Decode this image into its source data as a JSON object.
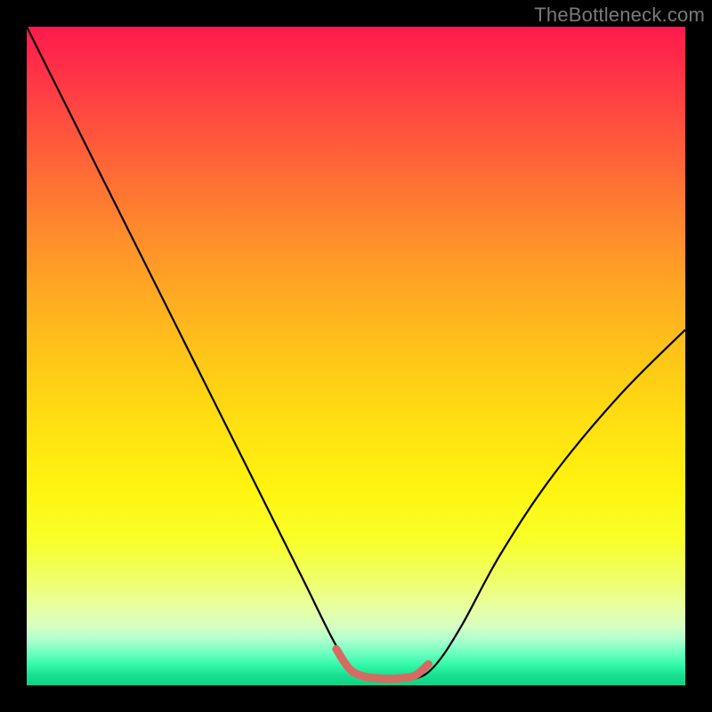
{
  "watermark": "TheBottleneck.com",
  "colors": {
    "background": "#000000",
    "curve_stroke": "#000000",
    "highlight_stroke": "#d66b63"
  },
  "chart_data": {
    "type": "line",
    "title": "",
    "xlabel": "",
    "ylabel": "",
    "xlim": [
      0,
      100
    ],
    "ylim": [
      0,
      100
    ],
    "series": [
      {
        "name": "bottleneck-curve",
        "x": [
          0,
          6,
          12,
          18,
          24,
          30,
          36,
          42,
          47,
          50,
          53,
          56,
          59,
          62,
          66,
          72,
          80,
          90,
          100
        ],
        "y": [
          100,
          88,
          76,
          64,
          52,
          40,
          28,
          16,
          6,
          2,
          1,
          1,
          1,
          3,
          9,
          20,
          32,
          44,
          54
        ]
      },
      {
        "name": "optimal-range-highlight",
        "x": [
          47,
          49,
          51,
          53,
          55,
          57,
          59,
          61
        ],
        "y": [
          5.5,
          2.5,
          1.4,
          1.1,
          1.0,
          1.1,
          1.5,
          3.2
        ]
      }
    ],
    "annotations": []
  }
}
